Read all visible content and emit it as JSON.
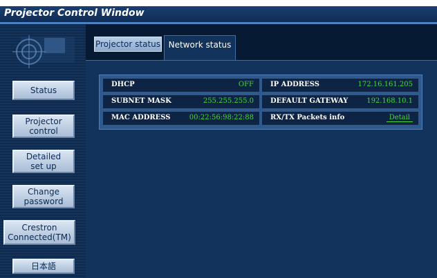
{
  "window": {
    "title": "Projector Control Window"
  },
  "sidebar": {
    "buttons": [
      {
        "line1": "Status",
        "line2": ""
      },
      {
        "line1": "Projector",
        "line2": "control"
      },
      {
        "line1": "Detailed",
        "line2": "set up"
      },
      {
        "line1": "Change",
        "line2": "password"
      },
      {
        "line1": "Crestron",
        "line2": "Connected(TM)"
      },
      {
        "line1": "日本語",
        "line2": ""
      }
    ]
  },
  "tabs": [
    {
      "label": "Projector status",
      "active": false
    },
    {
      "label": "Network status",
      "active": true
    }
  ],
  "network": {
    "dhcp": {
      "label": "DHCP",
      "value": "OFF"
    },
    "ip": {
      "label": "IP ADDRESS",
      "value": "172.16.161.205"
    },
    "subnet": {
      "label": "SUBNET MASK",
      "value": "255.255.255.0"
    },
    "gateway": {
      "label": "DEFAULT GATEWAY",
      "value": "192.168.10.1"
    },
    "mac": {
      "label": "MAC ADDRESS",
      "value": "00:22:56:98:22:88"
    },
    "packets": {
      "label": "RX/TX Packets info",
      "link": "Detail"
    }
  },
  "colors": {
    "value_green": "#48d838",
    "background_navy": "#0a2240"
  }
}
